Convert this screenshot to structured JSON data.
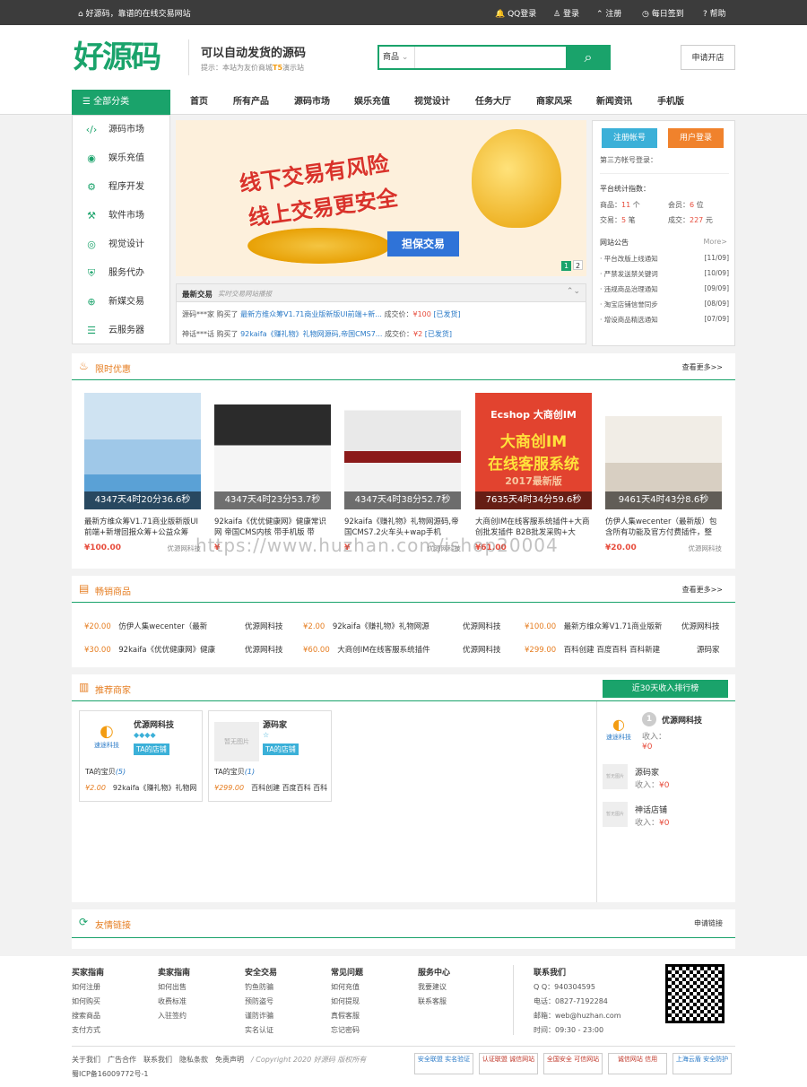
{
  "topbar": {
    "slogan": "好源码，靠谱的在线交易网站",
    "links": [
      "QQ登录",
      "登录",
      "注册",
      "每日签到",
      "帮助"
    ]
  },
  "header": {
    "logo_text": "好源码",
    "tagline": "可以自动发货的源码",
    "tip_prefix": "提示：本站为友价商城",
    "tip_highlight": "T5",
    "tip_suffix": "演示站",
    "search_scope": "商品",
    "apply_label": "申请开店"
  },
  "nav": {
    "allcat": "全部分类",
    "items": [
      "首页",
      "所有产品",
      "源码市场",
      "娱乐充值",
      "视觉设计",
      "任务大厅",
      "商家风采",
      "新闻资讯",
      "手机版"
    ]
  },
  "categories": [
    "源码市场",
    "娱乐充值",
    "程序开发",
    "软件市场",
    "视觉设计",
    "服务代办",
    "新媒交易",
    "云服务器"
  ],
  "banner": {
    "line1": "线下交易有风险",
    "line2": "线上交易更安全",
    "button": "担保交易",
    "pages": [
      "1",
      "2"
    ]
  },
  "deals": {
    "title": "最新交易",
    "subtitle": "实时交易网站播报",
    "rows": [
      {
        "user": "源码***家",
        "action": "购买了",
        "item": "最新方维众筹V1.71商业版新版UI前端+新...",
        "label": "成交价：",
        "price": "¥100",
        "status": "[已发货]"
      },
      {
        "user": "神话***话",
        "action": "购买了",
        "item": "92kaifa《赚礼物》礼物网源码,帝国CMS7...",
        "label": "成交价：",
        "price": "¥2",
        "status": "[已发货]"
      }
    ]
  },
  "side": {
    "register": "注册帐号",
    "login": "用户登录",
    "third_party": "第三方帐号登录：",
    "stats_title": "平台统计指数：",
    "stats": [
      {
        "label": "商品：",
        "value": "11",
        "unit": "个"
      },
      {
        "label": "会员：",
        "value": "6",
        "unit": "位"
      },
      {
        "label": "交易：",
        "value": "5",
        "unit": "笔"
      },
      {
        "label": "成交：",
        "value": "227",
        "unit": "元"
      }
    ],
    "ann_title": "网站公告",
    "ann_more": "More>",
    "announcements": [
      {
        "text": "· 平台改版上线通知",
        "date": "[11/09]"
      },
      {
        "text": "· 严禁发送禁关键词",
        "date": "[10/09]"
      },
      {
        "text": "· 违规商品治理通知",
        "date": "[09/09]"
      },
      {
        "text": "· 淘宝店铺信誉同步",
        "date": "[08/09]"
      },
      {
        "text": "· 增设商品精选通知",
        "date": "[07/09]"
      }
    ]
  },
  "flash": {
    "title": "限时优惠",
    "more": "查看更多>>",
    "products": [
      {
        "time": "4347天4时20分36.6秒",
        "name": "最新方维众筹V1.71商业版新版UI前端+新增回报众筹+公益众筹",
        "price": "¥100.00",
        "shop": "优源网科技"
      },
      {
        "time": "4347天4时23分53.7秒",
        "name": "92kaifa《优优健康网》健康常识网 帝国CMS内核 带手机版 带",
        "price": "¥",
        "shop": ""
      },
      {
        "time": "4347天4时38分52.7秒",
        "name": "92kaifa《赚礼物》礼物网源码,帝国CMS7.2火车头+wap手机",
        "price": "¥",
        "shop": "优源网科技"
      },
      {
        "time": "7635天4时34分59.6秒",
        "name": "大商创IM在线客服系统插件+大商创批发插件 B2B批发采购+大",
        "price": "¥61.00",
        "shop": ""
      },
      {
        "time": "9461天4时43分8.6秒",
        "name": "仿伊人集wecenter（最新版）包含所有功能及官方付费插件，整",
        "price": "¥20.00",
        "shop": "优源网科技"
      }
    ],
    "ecshop_text1": "Ecshop 大商创IM",
    "ecshop_text2": "大商创IM",
    "ecshop_text3": "在线客服系统",
    "ecshop_text4": "2017最新版"
  },
  "hot": {
    "title": "畅销商品",
    "more": "查看更多>>",
    "rows": [
      [
        {
          "price": "¥20.00",
          "name": "仿伊人集wecenter（最新",
          "shop": "优源网科技"
        },
        {
          "price": "¥2.00",
          "name": "92kaifa《赚礼物》礼物网源",
          "shop": "优源网科技"
        },
        {
          "price": "¥100.00",
          "name": "最新方维众筹V1.71商业版新",
          "shop": "优源网科技"
        }
      ],
      [
        {
          "price": "¥30.00",
          "name": "92kaifa《优优健康网》健康",
          "shop": "优源网科技"
        },
        {
          "price": "¥60.00",
          "name": "大商创IM在线客服系统插件",
          "shop": "优源网科技"
        },
        {
          "price": "¥299.00",
          "name": "百科创建 百度百科 百科新建",
          "shop": "源码家"
        }
      ]
    ]
  },
  "merchants": {
    "title": "推荐商家",
    "rank_button": "近30天收入排行榜",
    "cards": [
      {
        "name": "优源网科技",
        "logo": "速途科技",
        "tag": "TA的店铺",
        "items_label": "TA的宝贝",
        "count": "(5)",
        "price": "¥2.00",
        "item": "92kaifa《赚礼物》礼物网"
      },
      {
        "name": "源码家",
        "logo": "暂无图片",
        "tag": "TA的店铺",
        "items_label": "TA的宝贝",
        "count": "(1)",
        "price": "¥299.00",
        "item": "百科创建 百度百科 百科"
      }
    ],
    "ranking": [
      {
        "rank": "1",
        "name": "优源网科技",
        "income_label": "收入：",
        "income": "¥0",
        "logo": "速途科技"
      },
      {
        "rank": "",
        "name": "源码家",
        "income_label": "收入：",
        "income": "¥0",
        "logo": "暂无图片"
      },
      {
        "rank": "",
        "name": "神话店铺",
        "income_label": "收入：",
        "income": "¥0",
        "logo": "暂无图片"
      }
    ]
  },
  "friends": {
    "title": "友情链接",
    "apply": "申请链接"
  },
  "footer": {
    "cols": [
      {
        "title": "买家指南",
        "items": [
          "如何注册",
          "如何购买",
          "搜索商品",
          "支付方式"
        ]
      },
      {
        "title": "卖家指南",
        "items": [
          "如何出售",
          "收费标准",
          "入驻签约"
        ]
      },
      {
        "title": "安全交易",
        "items": [
          "钓鱼防骗",
          "预防盗号",
          "谨防诈骗",
          "实名认证"
        ]
      },
      {
        "title": "常见问题",
        "items": [
          "如何充值",
          "如何提现",
          "真假客服",
          "忘记密码"
        ]
      },
      {
        "title": "服务中心",
        "items": [
          "我要建议",
          "联系客服"
        ]
      }
    ],
    "contact_title": "联系我们",
    "contact": [
      "Q Q：940304595",
      "电话：0827-7192284",
      "邮箱：web@huzhan.com",
      "时间：09:30 - 23:00"
    ],
    "links": [
      "关于我们",
      "广告合作",
      "联系我们",
      "隐私条款",
      "免责声明"
    ],
    "copyright": "/ Copyright 2020 好源码 版权所有",
    "icp": "蜀ICP备16009772号-1",
    "badges": [
      "安全联盟 实名验证",
      "认证联盟 诚信网站",
      "全国安全 可信网站",
      "诚信网站 信用",
      "上海云盾 安全防护"
    ]
  },
  "watermark": "https://www.huzhan.com/ishop20004"
}
